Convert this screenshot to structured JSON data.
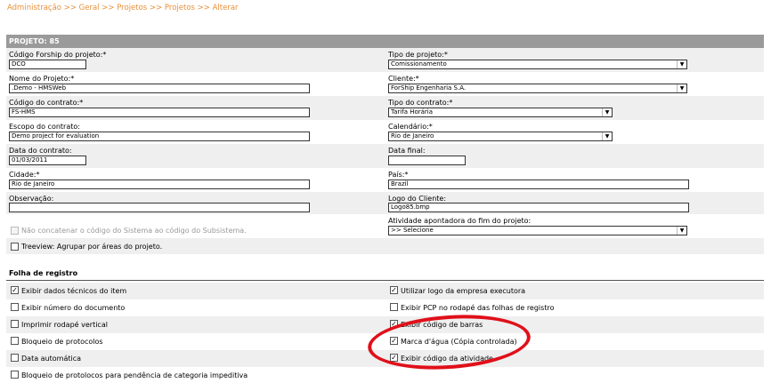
{
  "breadcrumb": {
    "items": [
      "Administração",
      "Geral",
      "Projetos",
      "Projetos",
      "Alterar"
    ],
    "separator": ">>"
  },
  "header": {
    "title": "PROJETO: 85"
  },
  "form": {
    "codigo_forship": {
      "label": "Código Forship do projeto:*",
      "value": "DCO"
    },
    "tipo_projeto": {
      "label": "Tipo de projeto:*",
      "value": "Comissionamento"
    },
    "nome_projeto": {
      "label": "Nome do Projeto:*",
      "value": ".Demo - HMSWeb"
    },
    "cliente": {
      "label": "Cliente:*",
      "value": "ForShip Engenharia S.A."
    },
    "codigo_contrato": {
      "label": "Código do contrato:*",
      "value": "FS-HMS"
    },
    "tipo_contrato": {
      "label": "Tipo do contrato:*",
      "value": "Tarifa Horária"
    },
    "escopo_contrato": {
      "label": "Escopo do contrato:",
      "value": "Demo project for evaluation"
    },
    "calendario": {
      "label": "Calendário:*",
      "value": "Rio de Janeiro"
    },
    "data_contrato": {
      "label": "Data do contrato:",
      "value": "01/03/2011"
    },
    "data_final": {
      "label": "Data final:",
      "value": ""
    },
    "cidade": {
      "label": "Cidade:*",
      "value": "Rio de Janeiro"
    },
    "pais": {
      "label": "País:*",
      "value": "Brazil"
    },
    "observacao": {
      "label": "Observação:",
      "value": ""
    },
    "logo_cliente": {
      "label": "Logo do Cliente:",
      "value": "Logo85.bmp"
    },
    "nao_concatenar": {
      "label": "Não concatenar o código do Sistema ao código do Subsistema.",
      "checked": false,
      "disabled": true
    },
    "atividade_fim": {
      "label": "Atividade apontadora do fim do projeto:",
      "value": ">> Selecione"
    },
    "treeview": {
      "label": "Treeview: Agrupar por áreas do projeto.",
      "checked": false
    }
  },
  "folha": {
    "title": "Folha de registro",
    "left": [
      {
        "label": "Exibir dados técnicos do item",
        "checked": true
      },
      {
        "label": "Exibir número do documento",
        "checked": false
      },
      {
        "label": "Imprimir rodapé vertical",
        "checked": false
      },
      {
        "label": "Bloqueio de protocolos",
        "checked": false
      },
      {
        "label": "Data automática",
        "checked": false
      },
      {
        "label": "Bloqueio de protolocos para pendência de categoria impeditiva",
        "checked": false
      }
    ],
    "right": [
      {
        "label": "Utilizar logo da empresa executora",
        "checked": true
      },
      {
        "label": "Exibir PCP no rodapé das folhas de registro",
        "checked": false
      },
      {
        "label": "Exibir código de barras",
        "checked": true
      },
      {
        "label": "Marca d'água (Cópia controlada)",
        "checked": true
      },
      {
        "label": "Exibir código da atividade",
        "checked": true
      }
    ]
  },
  "annotation": {
    "ellipse_color": "#e0101a"
  },
  "colors": {
    "header_bg": "#9a9a9a",
    "row_shade": "#efefef",
    "link": "#e8903a"
  }
}
